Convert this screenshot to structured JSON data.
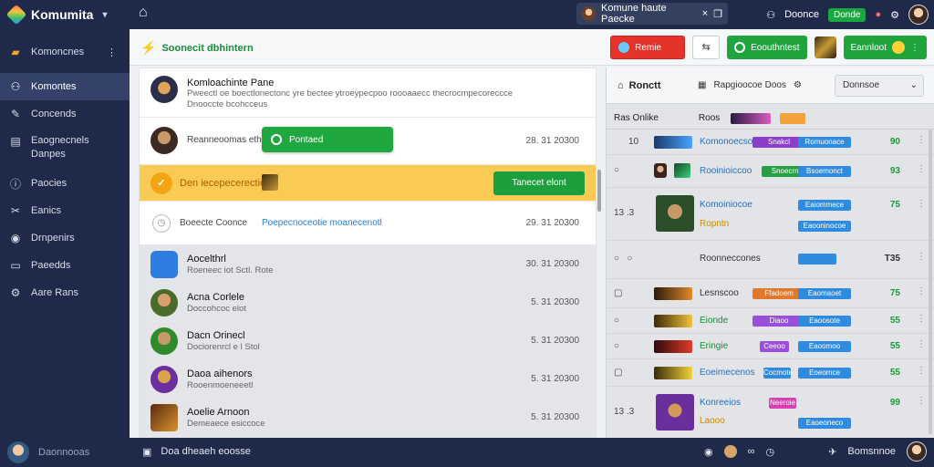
{
  "app": {
    "name": "Komumita",
    "top_pill_text": "Komune haute Paecke",
    "top_right_label": "Doonce",
    "top_chip": "Donde"
  },
  "sidebar": {
    "items": [
      {
        "label": "Komoncnes",
        "icon": "briefcase-icon",
        "more": "⋮"
      },
      {
        "label": "Komontes",
        "icon": "people-icon",
        "active": true
      },
      {
        "label": "Concends",
        "icon": "wrench-icon"
      },
      {
        "label": "Eaognecnels",
        "label2": "Danpes",
        "icon": "table-icon"
      },
      {
        "label": "Paocies",
        "icon": "info-icon"
      },
      {
        "label": "Eanics",
        "icon": "tools-icon"
      },
      {
        "label": "Drnpenirs",
        "icon": "globe-icon"
      },
      {
        "label": "Paeedds",
        "icon": "inbox-icon"
      },
      {
        "label": "Aare Rans",
        "icon": "gear-icon"
      }
    ]
  },
  "header": {
    "title": "Soonecit dbhintern",
    "red_button": "Remie",
    "swap": "⇆",
    "green_button": "Eoouthntest",
    "green_button2": "Eannloot"
  },
  "feed": {
    "items": [
      {
        "title": "Komloachinte Pane",
        "sub": "Pweectl oe boectlonectonc yre bectee ytroeypecpoo roooaaecc thecrocmpecoreccce",
        "sub2": "Dnooccte bcohcceus"
      },
      {
        "title": "Reanneoomas ethe",
        "chip": "Pontaed",
        "time": "28. 31 20300"
      },
      {
        "title": "Den iecepecerectie",
        "button": "Tanecet elont"
      },
      {
        "title": "Boeecte Coonce",
        "link": "Poepecnoceotie moanecenotl",
        "time": "29. 31 20300"
      },
      {
        "title": "Aocelthrl",
        "sub": "Roeneec iot Sctl. Rote",
        "time": "30. 31 20300"
      },
      {
        "title": "Acna Corlele",
        "sub": "Doccohcoc elot",
        "time": "5. 31 20300"
      },
      {
        "title": "Dacn Orinecl",
        "sub": "Dociorenrcl e l Stol",
        "time": "5. 31 20300"
      },
      {
        "title": "Daoa aihenors",
        "sub": "Rooenmoeneeetl",
        "time": "5. 31 20300"
      },
      {
        "title": "Aoelie Arnoon",
        "sub": "Demeaece esiccoce",
        "time": "5. 31 20300"
      }
    ]
  },
  "rpanel": {
    "title": "Ronctt",
    "tab": "Rapgioocoe Doos",
    "select": "Donnsoe",
    "colheads": [
      "Ras Onlike",
      "Roos"
    ],
    "rows": [
      {
        "no": "10",
        "name": "Komonoecsok",
        "tag1": "Snakcl",
        "tag2": "Romuonace",
        "score": "90"
      },
      {
        "no": "",
        "name": "Rooinioiccoo",
        "tag1": "Snoecrnat",
        "tag2": "Bsoemonct",
        "score": "93"
      },
      {
        "no": "13 .3",
        "name": "Komoiniocoe",
        "name2": "Ropntn",
        "tag1": "Eaiommece",
        "tag2": "Eaooninocoe",
        "score": "75"
      },
      {
        "no": "",
        "name": "Roonneccones",
        "score": "T35"
      },
      {
        "no": "",
        "name": "Lesnscoo",
        "tag1": "Ffadoem",
        "tag2": "Eaomaoet",
        "score": "75"
      },
      {
        "no": "",
        "name": "Eionde",
        "tag1": "Diaoo",
        "tag2": "Eaoosote",
        "score": "55"
      },
      {
        "no": "",
        "name": "Eringie",
        "tag1": "Ceeoo",
        "tag2": "Eaoomoo",
        "score": "55"
      },
      {
        "no": "",
        "name": "Eoeimecenos",
        "tag1": "Cocmote",
        "tag2": "Eoeomce",
        "score": "55"
      },
      {
        "no": "13 .3",
        "name": "Konreeios",
        "name2": "Laooo",
        "tag1": "Neeroie",
        "tag2": "Eaoeoneco",
        "score": "99"
      }
    ]
  },
  "footer": {
    "user": "Daonnooas",
    "compose": "Doa dheaeh eoosse",
    "right_label": "Bomsnnoe"
  }
}
